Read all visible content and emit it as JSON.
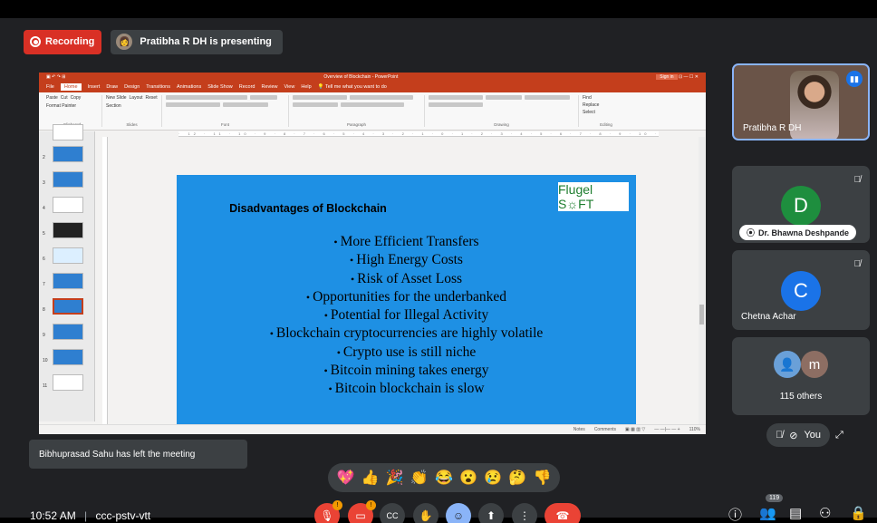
{
  "recording": {
    "label": "Recording"
  },
  "presenter": {
    "text": "Pratibha R DH is presenting"
  },
  "powerpoint": {
    "window_title": "Overview of Blockchain - PowerPoint",
    "sign_in": "Sign in",
    "tabs": [
      "File",
      "Home",
      "Insert",
      "Draw",
      "Design",
      "Transitions",
      "Animations",
      "Slide Show",
      "Record",
      "Review",
      "View",
      "Help",
      "Tell me what you want to do"
    ],
    "active_tab": "Home",
    "ribbon_groups": [
      "Clipboard",
      "Slides",
      "Font",
      "Paragraph",
      "Drawing",
      "Editing"
    ],
    "clipboard": {
      "paste": "Paste",
      "cut": "Cut",
      "copy": "Copy",
      "format_painter": "Format Painter"
    },
    "slides_group": {
      "new_slide": "New Slide",
      "layout": "Layout",
      "reset": "Reset",
      "section": "Section"
    },
    "editing": {
      "find": "Find",
      "replace": "Replace",
      "select": "Select"
    },
    "thumbnail_numbers": [
      "2",
      "3",
      "4",
      "5",
      "6",
      "7",
      "8",
      "9",
      "10",
      "11"
    ],
    "status": {
      "notes": "Notes",
      "comments": "Comments",
      "zoom": "110%"
    }
  },
  "slide": {
    "title": "Disadvantages of Blockchain",
    "logo": "Flugel S☼FT",
    "bullets": [
      "More Efficient Transfers",
      "High Energy Costs",
      "Risk of Asset Loss",
      "Opportunities for the underbanked",
      "Potential for Illegal Activity",
      "Blockchain cryptocurrencies are highly volatile",
      "Crypto use is still niche",
      "Bitcoin mining takes energy",
      "Bitcoin blockchain is slow"
    ]
  },
  "participants": {
    "presenter_tile": {
      "name": "Pratibha R DH"
    },
    "bhawna": {
      "initial": "D",
      "name": "Dr. Bhawna Deshpande",
      "color": "#1e8e3e"
    },
    "chetna": {
      "initial": "C",
      "name": "Chetna Achar",
      "color": "#1a73e8"
    },
    "others": {
      "initial": "m",
      "label": "115 others",
      "color": "#8d6e63"
    },
    "self": {
      "label": "You"
    }
  },
  "toast": {
    "text": "Bibhuprasad Sahu has left the meeting"
  },
  "reactions": [
    "💖",
    "👍",
    "🎉",
    "👏",
    "😂",
    "😮",
    "😢",
    "🤔",
    "👎"
  ],
  "bottom": {
    "time": "10:52 AM",
    "separator": "|",
    "meeting_code": "ccc-pstv-vtt",
    "people_count": "119",
    "badge": "!"
  }
}
